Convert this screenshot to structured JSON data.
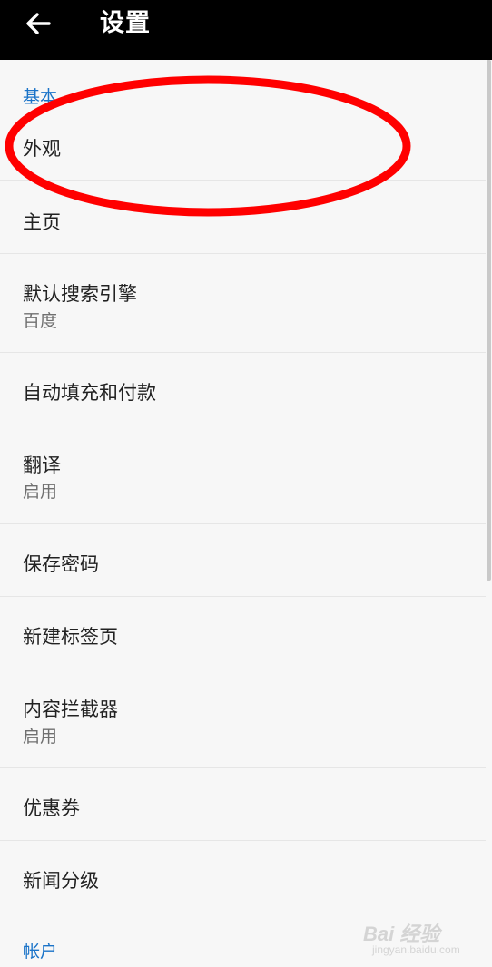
{
  "header": {
    "title": "设置",
    "back_icon": "arrow-left-icon"
  },
  "sections": {
    "basic": {
      "label": "基本",
      "items": [
        {
          "title": "外观"
        },
        {
          "title": "主页"
        },
        {
          "title": "默认搜索引擎",
          "subtitle": "百度"
        },
        {
          "title": "自动填充和付款"
        },
        {
          "title": "翻译",
          "subtitle": "启用"
        },
        {
          "title": "保存密码"
        },
        {
          "title": "新建标签页"
        },
        {
          "title": "内容拦截器",
          "subtitle": "启用"
        },
        {
          "title": "优惠券"
        },
        {
          "title": "新闻分级"
        }
      ]
    },
    "account": {
      "label": "帐户"
    }
  },
  "colors": {
    "header_bg": "#000000",
    "section_accent": "#1a73c8",
    "annotation": "#ff0000",
    "page_bg": "#f7f7f7"
  },
  "watermark": {
    "brand": "Bai 经验",
    "sub": "jingyan.baidu.com"
  }
}
